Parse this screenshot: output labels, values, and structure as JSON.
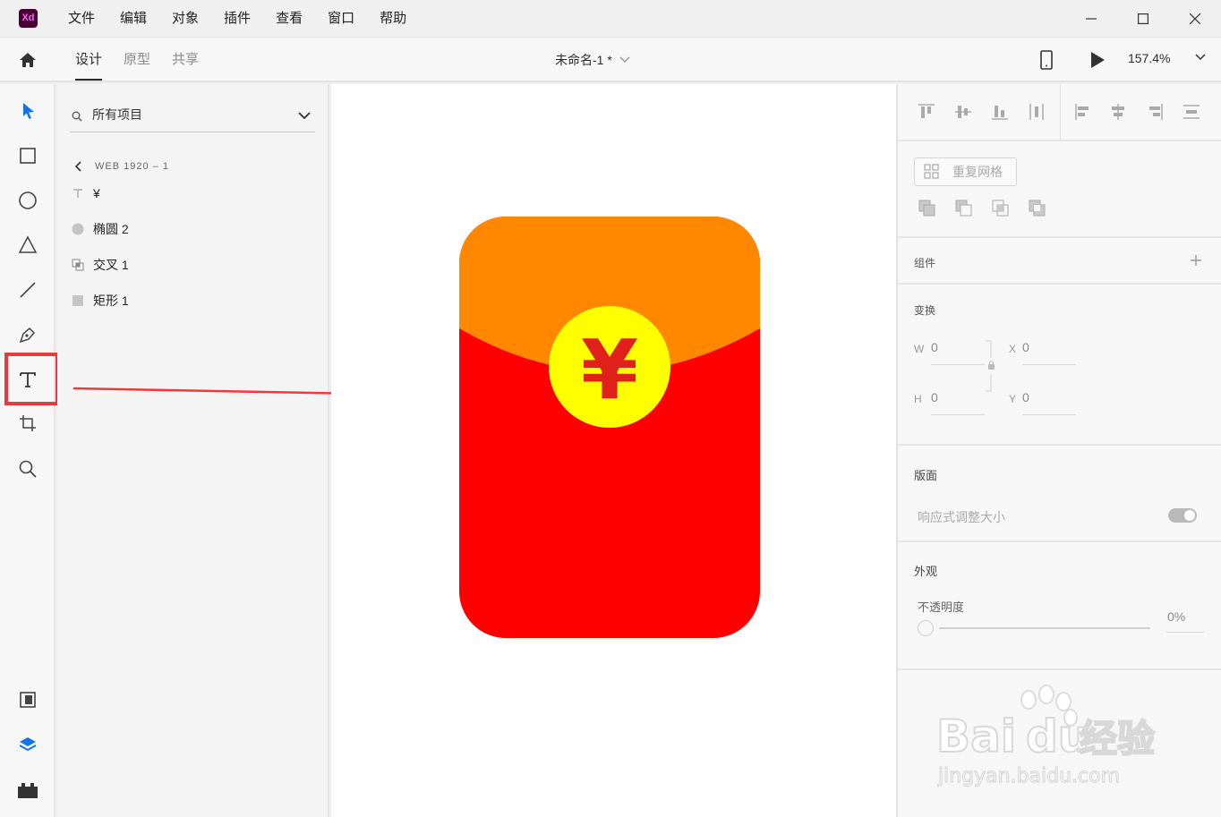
{
  "app": {
    "logo_text": "Xd"
  },
  "menu": [
    "文件",
    "编辑",
    "对象",
    "插件",
    "查看",
    "窗口",
    "帮助"
  ],
  "toolbar": {
    "tabs": [
      {
        "label": "设计",
        "active": true
      },
      {
        "label": "原型",
        "active": false
      },
      {
        "label": "共享",
        "active": false
      }
    ],
    "document_title": "未命名-1 *",
    "zoom": "157.4%"
  },
  "tools": [
    "select-tool",
    "rectangle-tool",
    "ellipse-tool",
    "polygon-tool",
    "line-tool",
    "pen-tool",
    "text-tool",
    "artboard-tool",
    "zoom-tool"
  ],
  "bottom_tools": [
    "assets-icon",
    "layers-icon",
    "plugins-icon"
  ],
  "layers": {
    "search_label": "所有项目",
    "artboard": "WEB 1920 – 1",
    "items": [
      {
        "icon": "text-icon",
        "name": "¥"
      },
      {
        "icon": "ellipse-icon",
        "name": "椭圆 2"
      },
      {
        "icon": "intersect-icon",
        "name": "交叉 1"
      },
      {
        "icon": "rectangle-icon",
        "name": "矩形 1"
      }
    ]
  },
  "canvas": {
    "envelope_symbol": "¥",
    "colors": {
      "body": "#ff0000",
      "flap": "#ff8800",
      "coin": "#ffff00",
      "symbol": "#e0201b"
    }
  },
  "props": {
    "repeat_grid_label": "重复网格",
    "component_title": "组件",
    "transform_title": "变换",
    "w_label": "W",
    "w_value": "0",
    "x_label": "X",
    "x_value": "0",
    "h_label": "H",
    "h_value": "0",
    "y_label": "Y",
    "y_value": "0",
    "layout_title": "版面",
    "responsive_label": "响应式调整大小",
    "appearance_title": "外观",
    "opacity_label": "不透明度",
    "opacity_value": "0%"
  },
  "watermark": {
    "brand": "Bai",
    "brand2": "du",
    "cn": "经验",
    "url": "jingyan.baidu.com"
  }
}
